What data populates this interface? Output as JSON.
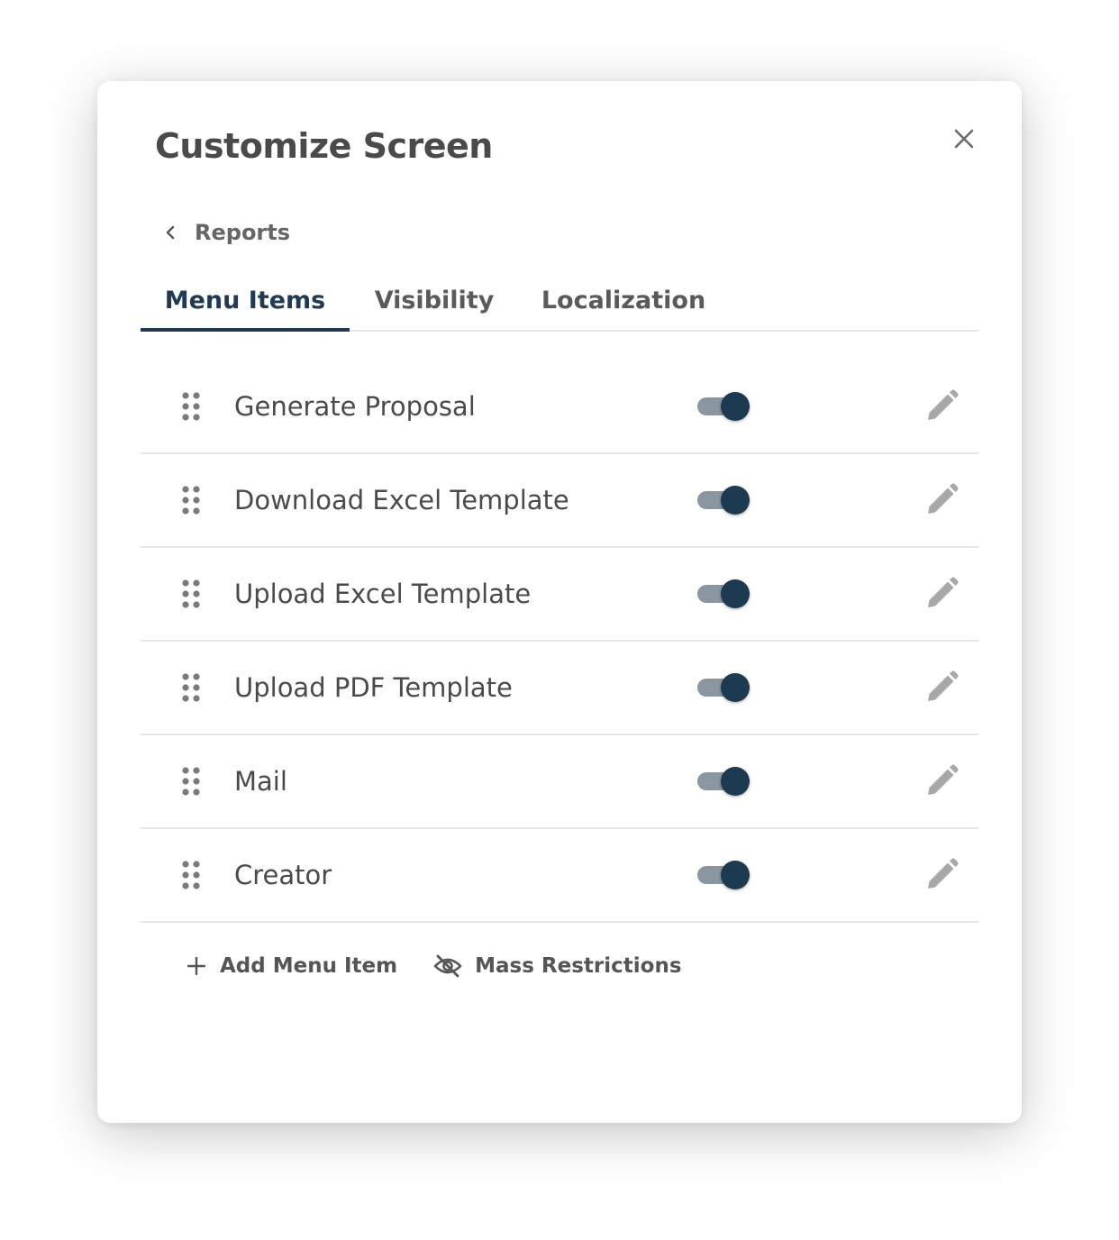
{
  "dialog": {
    "title": "Customize Screen",
    "close_icon": "close-icon"
  },
  "breadcrumb": {
    "icon": "chevron-left-icon",
    "label": "Reports"
  },
  "tabs": [
    {
      "label": "Menu Items",
      "active": true
    },
    {
      "label": "Visibility",
      "active": false
    },
    {
      "label": "Localization",
      "active": false
    }
  ],
  "menu_items": [
    {
      "label": "Generate Proposal",
      "enabled": true
    },
    {
      "label": "Download Excel Template",
      "enabled": true
    },
    {
      "label": "Upload Excel Template",
      "enabled": true
    },
    {
      "label": "Upload PDF Template",
      "enabled": true
    },
    {
      "label": "Mail",
      "enabled": true
    },
    {
      "label": "Creator",
      "enabled": true
    }
  ],
  "actions": {
    "add_label": "Add Menu Item",
    "add_icon": "plus-icon",
    "mass_label": "Mass Restrictions",
    "mass_icon": "eye-off-icon"
  },
  "colors": {
    "accent": "#1f3a52",
    "toggle_track": "#8a96a0",
    "toggle_thumb": "#1e3a50",
    "text": "#4a4a4a",
    "icon": "#a8a8a8",
    "divider": "#e6e6e6"
  }
}
